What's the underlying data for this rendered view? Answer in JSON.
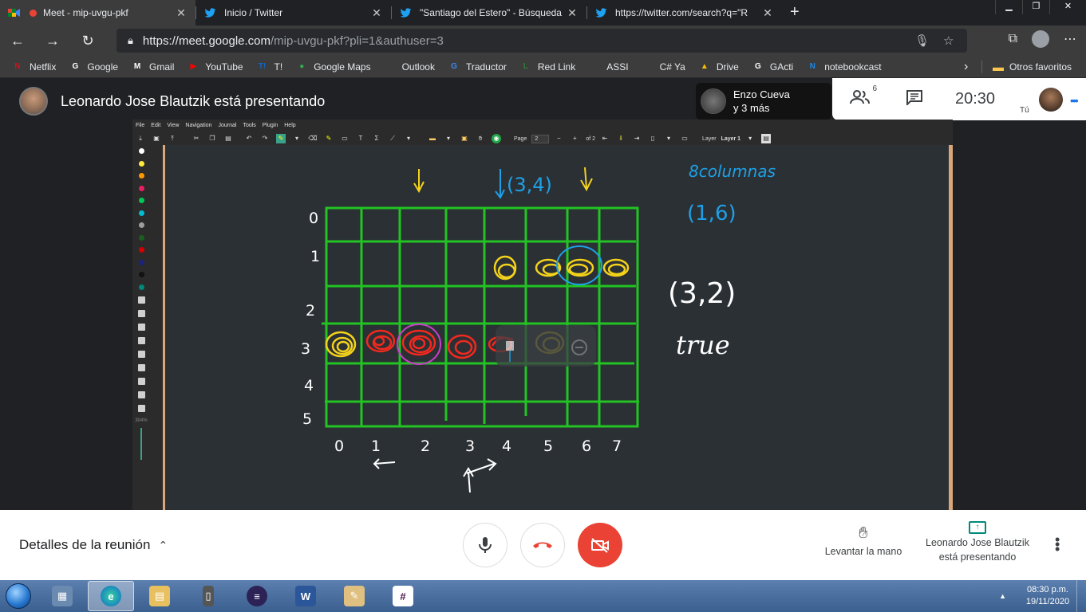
{
  "browser": {
    "tabs": [
      {
        "title": "Meet - mip-uvgu-pkf",
        "icon": "meet-icon",
        "active": true
      },
      {
        "title": "Inicio / Twitter",
        "icon": "twitter-icon",
        "active": false
      },
      {
        "title": "\"Santiago del Estero\" - Búsqueda",
        "icon": "twitter-icon",
        "active": false
      },
      {
        "title": "https://twitter.com/search?q=\"R",
        "icon": "twitter-icon",
        "active": false
      }
    ],
    "new_tab": "+",
    "url_host": "https://meet.google.com",
    "url_path": "/mip-uvgu-pkf?pli=1&authuser=3",
    "bookmarks": [
      {
        "label": "Netflix",
        "icon": "netflix-icon",
        "color": "#e50914",
        "glyph": "N"
      },
      {
        "label": "Google",
        "icon": "google-icon",
        "color": "#ffffff",
        "glyph": "G"
      },
      {
        "label": "Gmail",
        "icon": "gmail-icon",
        "color": "#ffffff",
        "glyph": "M"
      },
      {
        "label": "YouTube",
        "icon": "youtube-icon",
        "color": "#ff0000",
        "glyph": "▶"
      },
      {
        "label": "T!",
        "icon": "t-icon",
        "color": "#1565c0",
        "glyph": "T!"
      },
      {
        "label": "Google Maps",
        "icon": "maps-icon",
        "color": "#34a853",
        "glyph": "●"
      },
      {
        "label": "Outlook",
        "icon": "page-icon",
        "color": "#3c3c3c",
        "glyph": "▯"
      },
      {
        "label": "Traductor",
        "icon": "translate-icon",
        "color": "#4285f4",
        "glyph": "G"
      },
      {
        "label": "Red Link",
        "icon": "redlink-icon",
        "color": "#2e7d32",
        "glyph": "L"
      },
      {
        "label": "ASSI",
        "icon": "page-icon",
        "color": "#3c3c3c",
        "glyph": "▯"
      },
      {
        "label": "C# Ya",
        "icon": "page-icon",
        "color": "#3c3c3c",
        "glyph": "▯"
      },
      {
        "label": "Drive",
        "icon": "drive-icon",
        "color": "#fbbc04",
        "glyph": "▲"
      },
      {
        "label": "GActi",
        "icon": "google-icon",
        "color": "#ffffff",
        "glyph": "G"
      },
      {
        "label": "notebookcast",
        "icon": "notebookcast-icon",
        "color": "#1e88e5",
        "glyph": "N"
      }
    ],
    "other_bookmarks": "Otros favoritos"
  },
  "meet": {
    "presenter_text": "Leonardo Jose Blautzik está presentando",
    "tile_name_line1": "Enzo Cueva",
    "tile_name_line2": "y 3 más",
    "participants_count": "6",
    "time": "20:30",
    "self_label": "Tú",
    "meeting_details": "Detalles de la reunión",
    "raise_hand": "Levantar la mano",
    "presenting_line1": "Leonardo Jose Blautzik",
    "presenting_line2": "está presentando"
  },
  "xournal": {
    "menu": [
      "File",
      "Edit",
      "View",
      "Navigation",
      "Journal",
      "Tools",
      "Plugin",
      "Help"
    ],
    "page_label": "Page",
    "page_value": "2",
    "page_of": "of 2",
    "layer_label": "Layer",
    "layer_value": "Layer 1",
    "zoom_label": "304%",
    "pen_colors": [
      "#ffffff",
      "#ffeb3b",
      "#ff9800",
      "#e91e63",
      "#00c853",
      "#00bcd4",
      "#9e9e9e",
      "#1b5e20",
      "#d50000",
      "#1a237e",
      "#111111",
      "#00897b"
    ]
  },
  "board": {
    "row_labels": [
      "0",
      "1",
      "2",
      "3",
      "4",
      "5"
    ],
    "col_labels": [
      "0",
      "1",
      "2",
      "3",
      "4",
      "5",
      "6",
      "7"
    ],
    "note_top": "(3,4)",
    "note_columns": "8columnas",
    "note_pair1": "(1,6)",
    "note_pair2": "(3,2)",
    "note_true": "true",
    "grid_color": "#22c322",
    "yellow": "#f3d21b",
    "red": "#f2291e",
    "blue": "#1ea0e6",
    "magenta": "#c840c8"
  },
  "taskbar": {
    "time": "08:30 p.m.",
    "date": "19/11/2020",
    "apps": [
      "calculator-icon",
      "edge-icon",
      "explorer-icon",
      "usb-icon",
      "eclipse-icon",
      "word-icon",
      "paint-icon",
      "slack-icon"
    ]
  }
}
